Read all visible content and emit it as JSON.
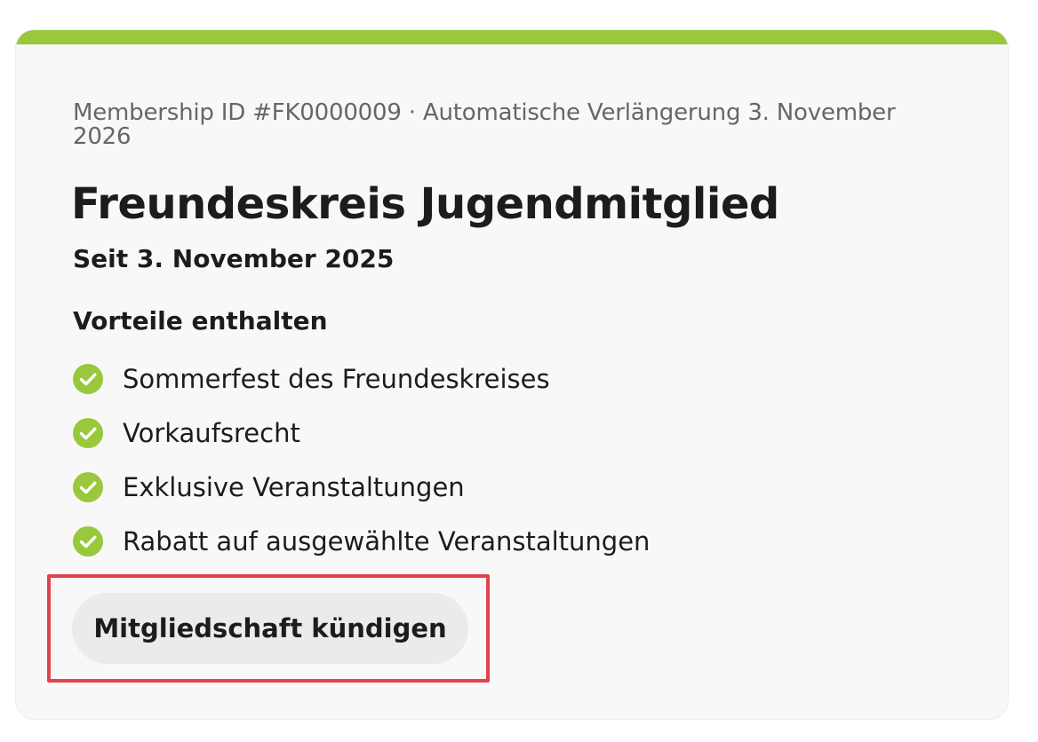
{
  "membership": {
    "meta": "Membership ID #FK0000009 · Automatische Verlängerung 3. November 2026",
    "title": "Freundeskreis Jugendmitglied",
    "since": "Seit 3. November 2025"
  },
  "benefits": {
    "heading": "Vorteile enthalten",
    "icon": "check-circle-icon",
    "items": [
      {
        "label": "Sommerfest des Freundeskreises"
      },
      {
        "label": "Vorkaufsrecht"
      },
      {
        "label": "Exklusive Veranstaltungen"
      },
      {
        "label": "Rabatt auf ausgewählte Veranstaltungen"
      }
    ]
  },
  "actions": {
    "cancel_label": "Mitgliedschaft kündigen"
  },
  "colors": {
    "accent": "#99c83c",
    "card_background": "#f8f8f8",
    "highlight": "#e0434b",
    "button_background": "#ebebeb"
  }
}
